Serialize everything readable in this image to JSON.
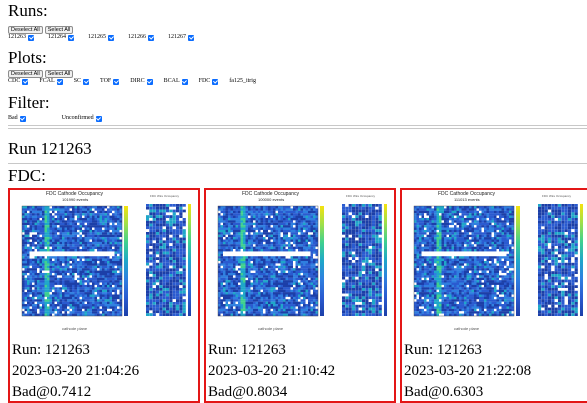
{
  "runs": {
    "title": "Runs:",
    "deselect_label": "Deselect All",
    "select_label": "Select All",
    "items": [
      {
        "label": "121263",
        "checked": true
      },
      {
        "label": "121264",
        "checked": true
      },
      {
        "label": "121265",
        "checked": true
      },
      {
        "label": "121266",
        "checked": true
      },
      {
        "label": "121267",
        "checked": true
      }
    ]
  },
  "plots": {
    "title": "Plots:",
    "deselect_label": "Deselect All",
    "select_label": "Select All",
    "items": [
      {
        "label": "CDC",
        "checked": true
      },
      {
        "label": "FCAL",
        "checked": true
      },
      {
        "label": "SC",
        "checked": true
      },
      {
        "label": "TOF",
        "checked": true
      },
      {
        "label": "DIRC",
        "checked": true
      },
      {
        "label": "BCAL",
        "checked": true
      },
      {
        "label": "FDC",
        "checked": true
      },
      {
        "label": "fa125_itrig",
        "checked": false
      }
    ]
  },
  "filter": {
    "title": "Filter:",
    "items": [
      {
        "label": "Bad",
        "checked": true
      },
      {
        "label": "Unconfirmed",
        "checked": true
      }
    ]
  },
  "run_heading": "Run 121263",
  "detector_heading": "FDC:",
  "cards": [
    {
      "plot_title": "FDC Cathode Occupancy",
      "events": "101990 events",
      "side_title": "FDC Wire Occupancy",
      "x_label": "cathode plane",
      "run": "Run: 121263",
      "timestamp": "2023-03-20 21:04:26",
      "bad": "Bad@0.7412"
    },
    {
      "plot_title": "FDC Cathode Occupancy",
      "events": "100000 events",
      "side_title": "FDC Wire Occupancy",
      "x_label": "cathode plane",
      "run": "Run: 121263",
      "timestamp": "2023-03-20 21:10:42",
      "bad": "Bad@0.8034"
    },
    {
      "plot_title": "FDC Cathode Occupancy",
      "events": "111013 events",
      "side_title": "FDC Wire Occupancy",
      "x_label": "cathode plane",
      "run": "Run: 121263",
      "timestamp": "2023-03-20 21:22:08",
      "bad": "Bad@0.6303"
    }
  ],
  "colors": {
    "checkbox": "#0a6cff",
    "card_border": "#e31616",
    "heat_low": "#1c3fa8",
    "heat_mid": "#1fa7c9",
    "heat_high": "#f5e20f"
  }
}
